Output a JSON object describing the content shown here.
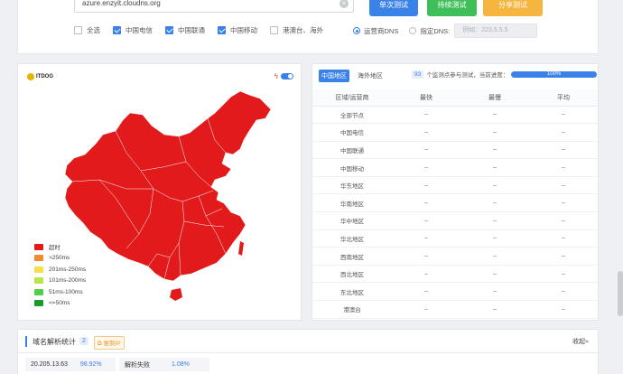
{
  "top": {
    "domain_value": "azure.enzyit.cloudns.org",
    "buttons": {
      "single_test": "单次测试",
      "continuous_test": "持续测试",
      "share": "分享测试"
    },
    "filters": [
      {
        "label": "全选",
        "checked": false
      },
      {
        "label": "中国电信",
        "checked": true
      },
      {
        "label": "中国联通",
        "checked": true
      },
      {
        "label": "中国移动",
        "checked": true
      },
      {
        "label": "港澳台、海外",
        "checked": false
      }
    ],
    "dns": {
      "option_isp": "运营商DNS",
      "option_custom": "指定DNS:",
      "placeholder": "例如：223.5.5.5"
    }
  },
  "map": {
    "logo_text": "ITDOG",
    "legend": [
      {
        "label": "超时",
        "color": "#e31a1c"
      },
      {
        "label": ">250ms",
        "color": "#f28a2e"
      },
      {
        "label": "201ms-250ms",
        "color": "#f5e04a"
      },
      {
        "label": "101ms-200ms",
        "color": "#b9e64a"
      },
      {
        "label": "51ms-100ms",
        "color": "#4fcf4a"
      },
      {
        "label": "<=50ms",
        "color": "#1a9a2a"
      }
    ],
    "fill_color": "#e31a1c"
  },
  "table": {
    "tabs": [
      "中国地区",
      "海外地区"
    ],
    "node_count": "93",
    "progress_label": "个监测点参与测试，当前进度：",
    "progress_percent": 100,
    "progress_text": "100%",
    "headers": [
      "区域/运营商",
      "最快",
      "最慢",
      "平均"
    ],
    "rows": [
      {
        "region": "全部节点",
        "fastest": "--",
        "slowest": "--",
        "average": "--"
      },
      {
        "region": "中国电信",
        "fastest": "--",
        "slowest": "--",
        "average": "--"
      },
      {
        "region": "中国联通",
        "fastest": "--",
        "slowest": "--",
        "average": "--"
      },
      {
        "region": "中国移动",
        "fastest": "--",
        "slowest": "--",
        "average": "--"
      },
      {
        "region": "华东地区",
        "fastest": "--",
        "slowest": "--",
        "average": "--"
      },
      {
        "region": "华南地区",
        "fastest": "--",
        "slowest": "--",
        "average": "--"
      },
      {
        "region": "华中地区",
        "fastest": "--",
        "slowest": "--",
        "average": "--"
      },
      {
        "region": "华北地区",
        "fastest": "--",
        "slowest": "--",
        "average": "--"
      },
      {
        "region": "西南地区",
        "fastest": "--",
        "slowest": "--",
        "average": "--"
      },
      {
        "region": "西北地区",
        "fastest": "--",
        "slowest": "--",
        "average": "--"
      },
      {
        "region": "东北地区",
        "fastest": "--",
        "slowest": "--",
        "average": "--"
      },
      {
        "region": "港澳台",
        "fastest": "--",
        "slowest": "--",
        "average": "--"
      }
    ]
  },
  "stats": {
    "title": "域名解析统计",
    "count": "2",
    "copy_ip": "复制IP",
    "collapse": "收起≈",
    "items": [
      {
        "ip": "20.205.13.63",
        "percent": "98.92%"
      },
      {
        "ip": "解析失败",
        "percent": "1.08%"
      }
    ]
  }
}
